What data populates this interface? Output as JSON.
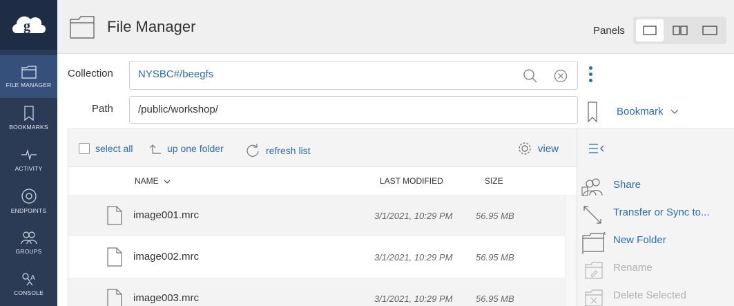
{
  "sidebar": {
    "logo": "globus-logo",
    "items": [
      {
        "label": "FILE MANAGER",
        "icon": "folder-icon",
        "active": true
      },
      {
        "label": "BOOKMARKS",
        "icon": "bookmark-icon"
      },
      {
        "label": "ACTIVITY",
        "icon": "activity-icon"
      },
      {
        "label": "ENDPOINTS",
        "icon": "endpoint-icon"
      },
      {
        "label": "GROUPS",
        "icon": "groups-icon"
      },
      {
        "label": "CONSOLE",
        "icon": "console-icon"
      }
    ]
  },
  "header": {
    "title": "File Manager",
    "panels_label": "Panels"
  },
  "collection": {
    "label": "Collection",
    "value": "NYSBC#/beegfs"
  },
  "path": {
    "label": "Path",
    "value": "/public/workshop/"
  },
  "bookmark": {
    "label": "Bookmark"
  },
  "toolbar": {
    "select_all": "select all",
    "up_one_folder": "up one folder",
    "refresh_list": "refresh list",
    "view": "view"
  },
  "table": {
    "columns": {
      "name": "NAME",
      "modified": "LAST MODIFIED",
      "size": "SIZE"
    },
    "rows": [
      {
        "name": "image001.mrc",
        "modified": "3/1/2021, 10:29 PM",
        "size": "56.95 MB"
      },
      {
        "name": "image002.mrc",
        "modified": "3/1/2021, 10:29 PM",
        "size": "56.95 MB"
      },
      {
        "name": "image003.mrc",
        "modified": "3/1/2021, 10:29 PM",
        "size": "56.95 MB"
      }
    ]
  },
  "actions": {
    "share": "Share",
    "transfer": "Transfer or Sync to...",
    "new_folder": "New Folder",
    "rename": "Rename",
    "delete": "Delete Selected"
  },
  "colors": {
    "accent": "#2a6db5",
    "sidebar": "#2b3a55",
    "sidebar_active": "#35507b"
  }
}
